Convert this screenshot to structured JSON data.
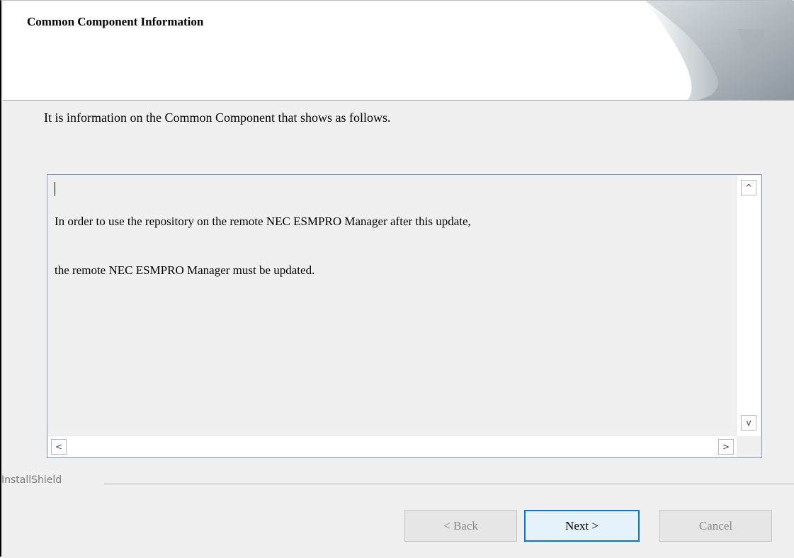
{
  "header": {
    "title": "Common Component Information"
  },
  "intro_text": "It is information on the Common Component that shows as follows.",
  "info_box": {
    "line1": "In order to use the repository on the remote NEC ESMPRO Manager after this update,",
    "line2": "the remote NEC ESMPRO Manager must be updated."
  },
  "scroll_glyphs": {
    "up": "^",
    "down": "v",
    "left": "<",
    "right": ">"
  },
  "footer": {
    "brand": "InstallShield",
    "back_label": "< Back",
    "next_label": "Next >",
    "cancel_label": "Cancel"
  }
}
